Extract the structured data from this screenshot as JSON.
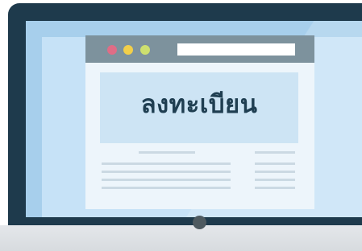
{
  "illustration": {
    "register_title": "ลงทะเบียน"
  }
}
